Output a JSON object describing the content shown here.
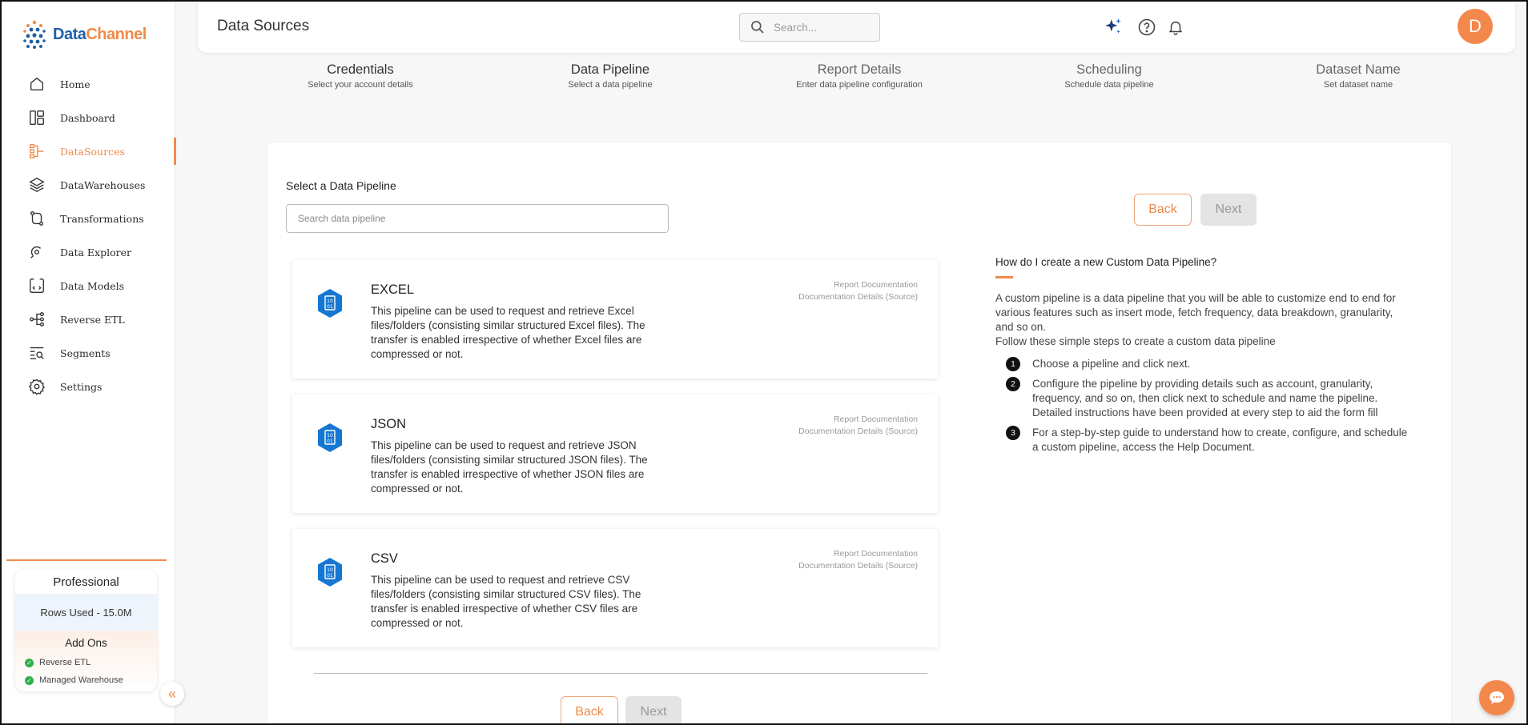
{
  "brand": {
    "name_part1": "Data",
    "name_part2": "Channel",
    "primary_color": "#1f5fa8",
    "accent_color": "#f08a4b"
  },
  "sidebar": {
    "items": [
      {
        "label": "Home",
        "icon": "home-icon"
      },
      {
        "label": "Dashboard",
        "icon": "dashboard-icon"
      },
      {
        "label": "DataSources",
        "icon": "datasources-icon",
        "active": true
      },
      {
        "label": "DataWarehouses",
        "icon": "layers-icon"
      },
      {
        "label": "Transformations",
        "icon": "transform-icon"
      },
      {
        "label": "Data Explorer",
        "icon": "explorer-icon"
      },
      {
        "label": "Data Models",
        "icon": "models-icon"
      },
      {
        "label": "Reverse ETL",
        "icon": "reverse-etl-icon"
      },
      {
        "label": "Segments",
        "icon": "segments-icon"
      },
      {
        "label": "Settings",
        "icon": "gear-icon"
      }
    ],
    "plan": {
      "title": "Professional",
      "rows_used": "Rows Used - 15.0M",
      "addons_title": "Add Ons",
      "addons": [
        "Reverse ETL",
        "Managed Warehouse"
      ]
    }
  },
  "header": {
    "title": "Data Sources",
    "search_placeholder": "Search...",
    "avatar_initial": "D"
  },
  "stepper": {
    "steps": [
      {
        "title": "Credentials",
        "subtitle": "Select your account details",
        "state": "done"
      },
      {
        "title": "Data Pipeline",
        "subtitle": "Select a data pipeline",
        "state": "current"
      },
      {
        "title": "Report Details",
        "subtitle": "Enter data pipeline configuration",
        "state": "pending"
      },
      {
        "title": "Scheduling",
        "subtitle": "Schedule data pipeline",
        "state": "pending"
      },
      {
        "title": "Dataset Name",
        "subtitle": "Set dataset name",
        "state": "pending"
      }
    ]
  },
  "main": {
    "select_label": "Select a Data Pipeline",
    "search_placeholder": "Search data pipeline",
    "back_label": "Back",
    "next_label": "Next",
    "pipelines": [
      {
        "name": "EXCEL",
        "description": "This pipeline can be used to request and retrieve Excel files/folders (consisting similar structured Excel files). The transfer is enabled irrespective of whether Excel files are compressed or not.",
        "link1": "Report Documentation",
        "link2": "Documentation Details (Source)"
      },
      {
        "name": "JSON",
        "description": "This pipeline can be used to request and retrieve JSON files/folders (consisting similar structured JSON files). The transfer is enabled irrespective of whether JSON files are compressed or not.",
        "link1": "Report Documentation",
        "link2": "Documentation Details (Source)"
      },
      {
        "name": "CSV",
        "description": "This pipeline can be used to request and retrieve CSV files/folders (consisting similar structured CSV files). The transfer is enabled irrespective of whether CSV files are compressed or not.",
        "link1": "Report Documentation",
        "link2": "Documentation Details (Source)"
      }
    ],
    "pipeline_icon": "file-binary-icon"
  },
  "help": {
    "title": "How do I create a new Custom Data Pipeline?",
    "paragraph": "A custom pipeline is a data pipeline that you will be able to customize end to end for various features such as insert mode, fetch frequency, data breakdown, granularity, and so on.",
    "intro": "Follow these simple steps to create a custom data pipeline",
    "steps": [
      {
        "num": "1",
        "text": "Choose a pipeline and click next."
      },
      {
        "num": "2",
        "text": "Configure the pipeline by providing details such as account, granularity, frequency, and so on, then click next to schedule and name the pipeline. Detailed instructions have been provided at every step to aid the form fill"
      },
      {
        "num": "3",
        "text": "For a step-by-step guide to understand how to create, configure, and schedule a custom pipeline, access the Help Document."
      }
    ]
  }
}
